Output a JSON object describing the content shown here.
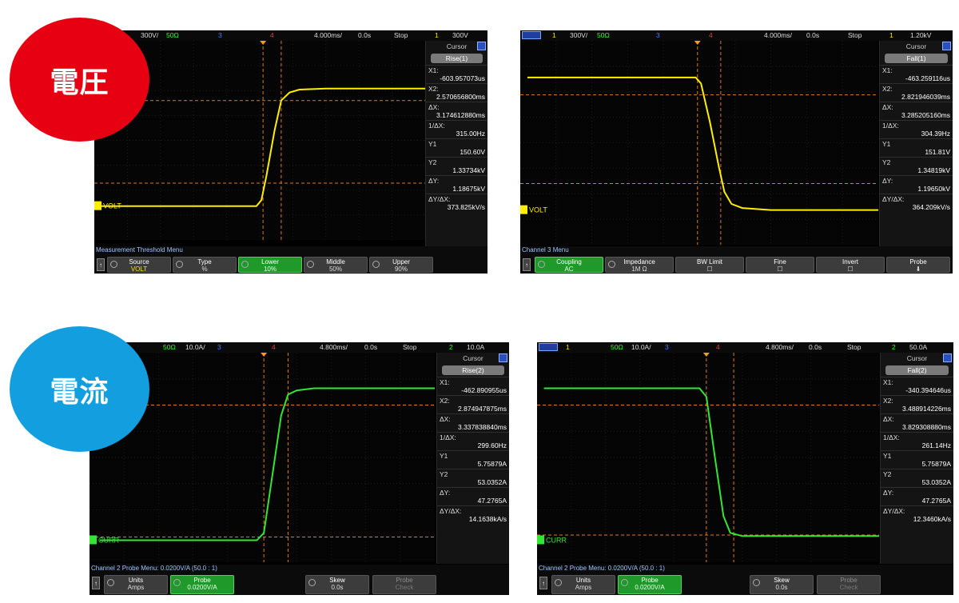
{
  "badges": {
    "voltage": "電圧",
    "current": "電流",
    "voltage_color": "#e60012",
    "current_color": "#139ee0"
  },
  "colors": {
    "voltage_trace": "#ffee00",
    "current_trace": "#33e633",
    "cursor_line": "#e07a1a"
  },
  "panels": [
    {
      "id": "v-rise",
      "top": {
        "ch": "1",
        "scale": "300V/",
        "imp": "50Ω",
        "b": "3",
        "r": "4",
        "time": "4.000ms/",
        "delay": "0.0s",
        "mode": "Stop",
        "trig_ch": "1",
        "trig_val": "300V"
      },
      "side": {
        "head": "Cursor",
        "pill": "Rise(1)",
        "rows": [
          {
            "k": "X1:",
            "v": "-603.957073us"
          },
          {
            "k": "X2:",
            "v": "2.570656800ms"
          },
          {
            "k": "ΔX:",
            "v": "3.174612880ms"
          },
          {
            "k": "1/ΔX:",
            "v": "315.00Hz"
          },
          {
            "k": "Y1",
            "v": "150.60V"
          },
          {
            "k": "Y2",
            "v": "1.33734kV"
          },
          {
            "k": "ΔY:",
            "v": "1.18675kV"
          },
          {
            "k": "ΔY/ΔX:",
            "v": "373.825kV/s"
          }
        ]
      },
      "channel_label": "VOLT",
      "menu_title": "Measurement Threshold Menu",
      "buttons": [
        {
          "label": "Source",
          "value": "VOLT"
        },
        {
          "label": "Type",
          "value": "%"
        },
        {
          "label": "Lower",
          "value": "10%"
        },
        {
          "label": "Middle",
          "value": "50%"
        },
        {
          "label": "Upper",
          "value": "90%"
        }
      ]
    },
    {
      "id": "v-fall",
      "top": {
        "ch": "1",
        "scale": "300V/",
        "imp": "50Ω",
        "b": "3",
        "r": "4",
        "time": "4.000ms/",
        "delay": "0.0s",
        "mode": "Stop",
        "trig_ch": "1",
        "trig_val": "1.20kV"
      },
      "side": {
        "head": "Cursor",
        "pill": "Fall(1)",
        "rows": [
          {
            "k": "X1:",
            "v": "-463.259116us"
          },
          {
            "k": "X2:",
            "v": "2.821946039ms"
          },
          {
            "k": "ΔX:",
            "v": "3.285205160ms"
          },
          {
            "k": "1/ΔX:",
            "v": "304.39Hz"
          },
          {
            "k": "Y1",
            "v": "151.81V"
          },
          {
            "k": "Y2",
            "v": "1.34819kV"
          },
          {
            "k": "ΔY:",
            "v": "1.19650kV"
          },
          {
            "k": "ΔY/ΔX:",
            "v": "364.209kV/s"
          }
        ]
      },
      "channel_label": "VOLT",
      "menu_title": "Channel 3 Menu",
      "buttons": [
        {
          "label": "Coupling",
          "value": "AC"
        },
        {
          "label": "Impedance",
          "value": "1M Ω"
        },
        {
          "label": "BW Limit",
          "value": ""
        },
        {
          "label": "Fine",
          "value": ""
        },
        {
          "label": "Invert",
          "value": ""
        },
        {
          "label": "Probe",
          "value": ""
        }
      ]
    },
    {
      "id": "i-rise",
      "top": {
        "ch": "1",
        "scale": "10.0A/",
        "imp": "50Ω",
        "b": "3",
        "r": "4",
        "time": "4.800ms/",
        "delay": "0.0s",
        "mode": "Stop",
        "trig_ch": "2",
        "trig_val": "10.0A"
      },
      "side": {
        "head": "Cursor",
        "pill": "Rise(2)",
        "rows": [
          {
            "k": "X1:",
            "v": "-462.890955us"
          },
          {
            "k": "X2:",
            "v": "2.874947875ms"
          },
          {
            "k": "ΔX:",
            "v": "3.337838840ms"
          },
          {
            "k": "1/ΔX:",
            "v": "299.60Hz"
          },
          {
            "k": "Y1",
            "v": "5.75879A"
          },
          {
            "k": "Y2",
            "v": "53.0352A"
          },
          {
            "k": "ΔY:",
            "v": "47.2765A"
          },
          {
            "k": "ΔY/ΔX:",
            "v": "14.1638kA/s"
          }
        ]
      },
      "channel_label": "CURR",
      "menu_title": "Channel 2 Probe Menu: 0.0200V/A (50.0 : 1)",
      "buttons": [
        {
          "label": "Units",
          "value": "Amps"
        },
        {
          "label": "Probe",
          "value": "0.0200V/A"
        },
        {
          "label": "",
          "value": ""
        },
        {
          "label": "Skew",
          "value": "0.0s"
        },
        {
          "label": "Probe",
          "value": "Check"
        }
      ]
    },
    {
      "id": "i-fall",
      "top": {
        "ch": "1",
        "scale": "10.0A/",
        "imp": "50Ω",
        "b": "3",
        "r": "4",
        "time": "4.800ms/",
        "delay": "0.0s",
        "mode": "Stop",
        "trig_ch": "2",
        "trig_val": "50.0A"
      },
      "side": {
        "head": "Cursor",
        "pill": "Fall(2)",
        "rows": [
          {
            "k": "X1:",
            "v": "-340.394646us"
          },
          {
            "k": "X2:",
            "v": "3.488914226ms"
          },
          {
            "k": "ΔX:",
            "v": "3.829308880ms"
          },
          {
            "k": "1/ΔX:",
            "v": "261.14Hz"
          },
          {
            "k": "Y1",
            "v": "5.75879A"
          },
          {
            "k": "Y2",
            "v": "53.0352A"
          },
          {
            "k": "ΔY:",
            "v": "47.2765A"
          },
          {
            "k": "ΔY/ΔX:",
            "v": "12.3460kA/s"
          }
        ]
      },
      "channel_label": "CURR",
      "menu_title": "Channel 2 Probe Menu: 0.0200V/A (50.0 : 1)",
      "buttons": [
        {
          "label": "Units",
          "value": "Amps"
        },
        {
          "label": "Probe",
          "value": "0.0200V/A"
        },
        {
          "label": "",
          "value": ""
        },
        {
          "label": "Skew",
          "value": "0.0s"
        },
        {
          "label": "Probe",
          "value": "Check"
        }
      ]
    }
  ]
}
